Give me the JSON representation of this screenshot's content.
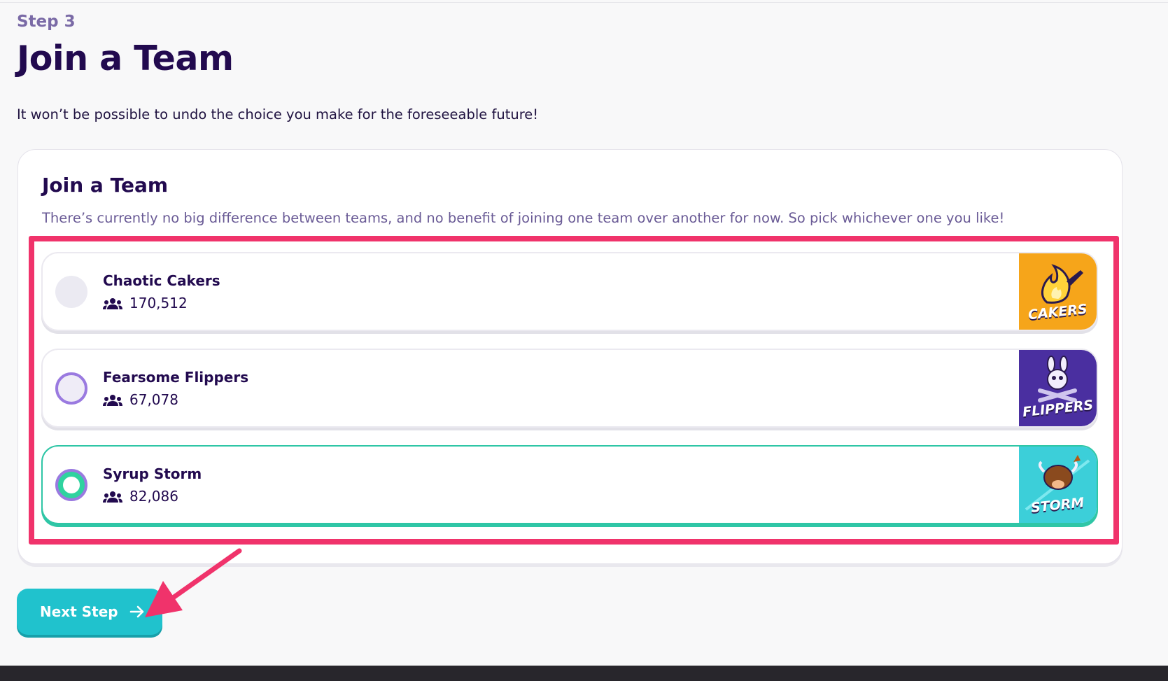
{
  "step": {
    "label": "Step 3",
    "title": "Join a Team"
  },
  "warning": "It won’t be possible to undo the choice you make for the foreseeable future!",
  "card": {
    "title": "Join a Team",
    "description": "There’s currently no big difference between teams, and no benefit of joining one team over another for now. So pick whichever one you like!"
  },
  "teams": [
    {
      "name": "Chaotic Cakers",
      "members": "170,512",
      "state": "unselected",
      "logo_text": "CAKERS",
      "logo_color": "#f6a51a",
      "icon": "flame-cake-icon"
    },
    {
      "name": "Fearsome Flippers",
      "members": "67,078",
      "state": "hover",
      "logo_text": "FLIPPERS",
      "logo_color": "#4a2fa0",
      "icon": "bunny-skull-spatula-icon"
    },
    {
      "name": "Syrup Storm",
      "members": "82,086",
      "state": "selected",
      "logo_text": "STORM",
      "logo_color": "#3ccfd9",
      "icon": "bull-syrup-icon"
    }
  ],
  "next_button": {
    "label": "Next Step",
    "icon": "arrow-right-icon"
  },
  "colors": {
    "title": "#220a4f",
    "highlight": "#f0336b",
    "button": "#20c2cd",
    "selected_border": "#2fc6a6",
    "radio_ring": "#9a7ae0"
  }
}
